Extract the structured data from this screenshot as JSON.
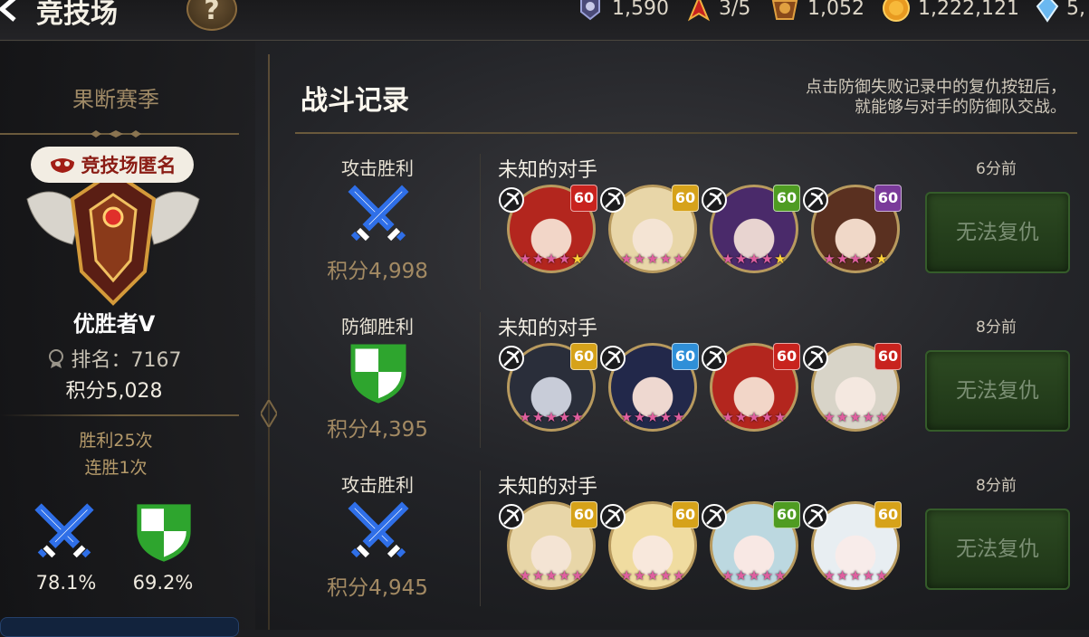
{
  "header": {
    "title": "竞技场",
    "help_label": "?"
  },
  "resources": [
    {
      "icon": "arena-flag-icon",
      "value": "1,590"
    },
    {
      "icon": "ticket-icon",
      "value": "3/5"
    },
    {
      "icon": "trophy-coin-icon",
      "value": "1,052"
    },
    {
      "icon": "gold-coin-icon",
      "value": "1,222,121"
    },
    {
      "icon": "crystal-icon",
      "value": "5,"
    }
  ],
  "sidebar": {
    "season": "果断赛季",
    "anonymous_label": "竞技场匿名",
    "rank_name": "优胜者V",
    "rank_label": "排名：7167",
    "score_label": "积分5,028",
    "wins_label": "胜利25次",
    "streak_label": "连胜1次",
    "attack_rate": "78.1%",
    "defense_rate": "69.2%"
  },
  "main": {
    "title": "战斗记录",
    "hint_line1": "点击防御失败记录中的复仇按钮后，",
    "hint_line2": "就能够与对手的防御队交战。"
  },
  "colors": {
    "attack": "#2f6fe8",
    "defense": "#2ea52e",
    "level_red": "#c8231e",
    "level_gold": "#d6a21a",
    "level_green": "#4f9c22",
    "level_purple": "#7a3a9a",
    "level_blue": "#2f8fd8"
  },
  "records": [
    {
      "type": "攻击胜利",
      "kind": "attack",
      "score": "积分4,998",
      "opponent": "未知的对手",
      "time": "6分前",
      "button": "无法复仇",
      "heroes": [
        {
          "level": "60",
          "level_color": "red",
          "class_icon": "ranger-icon",
          "portrait": "red-hair",
          "gold_stars": 1
        },
        {
          "level": "60",
          "level_color": "gold",
          "class_icon": "ranger-icon",
          "portrait": "blonde",
          "gold_stars": 0
        },
        {
          "level": "60",
          "level_color": "green",
          "class_icon": "assassin-icon",
          "portrait": "purple",
          "gold_stars": 1
        },
        {
          "level": "60",
          "level_color": "purple",
          "class_icon": "ranger-icon",
          "portrait": "brown",
          "gold_stars": 1
        }
      ]
    },
    {
      "type": "防御胜利",
      "kind": "defense",
      "score": "积分4,395",
      "opponent": "未知的对手",
      "time": "8分前",
      "button": "无法复仇",
      "heroes": [
        {
          "level": "60",
          "level_color": "gold",
          "class_icon": "ranger-icon",
          "portrait": "masked",
          "gold_stars": 0
        },
        {
          "level": "60",
          "level_color": "blue",
          "class_icon": "archer-icon",
          "portrait": "navy",
          "gold_stars": 0
        },
        {
          "level": "60",
          "level_color": "red",
          "class_icon": "ranger-icon",
          "portrait": "red-hair",
          "gold_stars": 0
        },
        {
          "level": "60",
          "level_color": "red",
          "class_icon": "mage-icon",
          "portrait": "silver",
          "gold_stars": 0
        }
      ]
    },
    {
      "type": "攻击胜利",
      "kind": "attack",
      "score": "积分4,945",
      "opponent": "未知的对手",
      "time": "8分前",
      "button": "无法复仇",
      "heroes": [
        {
          "level": "60",
          "level_color": "gold",
          "class_icon": "ranger-icon",
          "portrait": "blonde",
          "gold_stars": 0
        },
        {
          "level": "60",
          "level_color": "gold",
          "class_icon": "mage-icon",
          "portrait": "fair",
          "gold_stars": 0
        },
        {
          "level": "60",
          "level_color": "green",
          "class_icon": "healer-icon",
          "portrait": "teal",
          "gold_stars": 0
        },
        {
          "level": "60",
          "level_color": "gold",
          "class_icon": "knight-icon",
          "portrait": "white",
          "gold_stars": 0
        }
      ]
    }
  ]
}
